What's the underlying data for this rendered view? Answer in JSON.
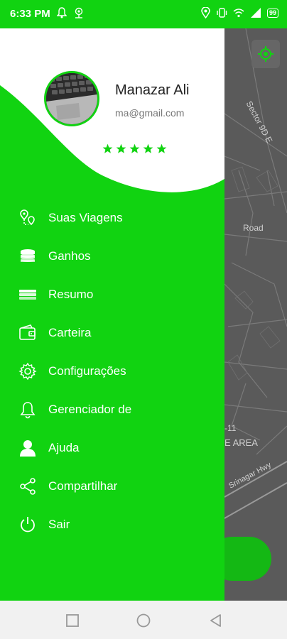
{
  "status_bar": {
    "time": "6:33 PM",
    "battery": "99",
    "icons": [
      "bell-icon",
      "location-outline-icon",
      "location-pin-icon",
      "vibrate-icon",
      "wifi-icon",
      "signal-icon",
      "battery-icon"
    ]
  },
  "profile": {
    "name": "Manazar Ali",
    "email": "ma@gmail.com",
    "rating": 5
  },
  "menu": [
    {
      "label": "Suas Viagens",
      "icon": "trips-pin-icon"
    },
    {
      "label": "Ganhos",
      "icon": "coins-icon"
    },
    {
      "label": "Resumo",
      "icon": "cash-stack-icon"
    },
    {
      "label": "Carteira",
      "icon": "wallet-icon"
    },
    {
      "label": "Configurações",
      "icon": "gear-icon"
    },
    {
      "label": "Gerenciador de",
      "icon": "bell-icon"
    },
    {
      "label": "Ajuda",
      "icon": "user-icon"
    },
    {
      "label": "Compartilhar",
      "icon": "share-icon"
    },
    {
      "label": "Sair",
      "icon": "power-icon"
    }
  ],
  "map": {
    "labels": [
      "Sector 9D E",
      "Road",
      "-11",
      "E AREA",
      "Srinagar Hwy"
    ]
  },
  "colors": {
    "brand_green": "#11d311",
    "map_gray": "#5a5a5a"
  }
}
